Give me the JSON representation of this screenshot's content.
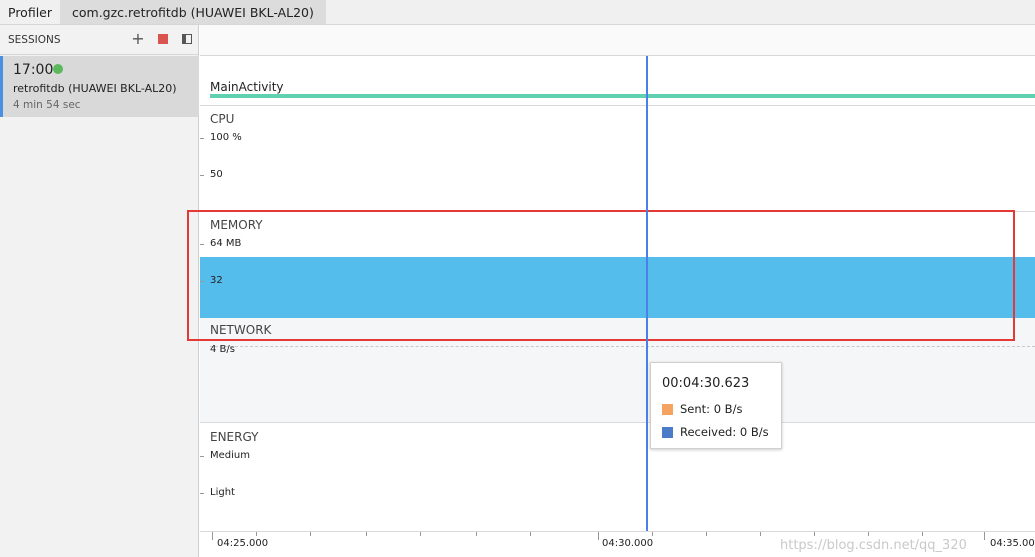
{
  "topbar": {
    "app_tab": "Profiler",
    "process_tab": "com.gzc.retrofitdb (HUAWEI BKL-AL20)"
  },
  "sessions": {
    "header": "SESSIONS",
    "item": {
      "time": "17:00",
      "device": "retrofitdb (HUAWEI BKL-AL20)",
      "duration": "4 min 54 sec",
      "status_color": "#5cb85c"
    }
  },
  "lanes": {
    "activity": {
      "label": "MainActivity",
      "color": "#5fd0b0"
    },
    "cpu": {
      "title": "CPU",
      "max_label": "100 %",
      "mid_label": "50"
    },
    "memory": {
      "title": "MEMORY",
      "max_label": "64 MB",
      "mid_label": "32",
      "fill_color": "#55bdec"
    },
    "network": {
      "title": "NETWORK",
      "max_label": "4 B/s"
    },
    "energy": {
      "title": "ENERGY",
      "high_label": "Medium",
      "low_label": "Light"
    }
  },
  "tooltip": {
    "time": "00:04:30.623",
    "sent": "Sent: 0 B/s",
    "received": "Received: 0 B/s",
    "sent_color": "#f4a460",
    "received_color": "#4a7cc7"
  },
  "timeline": {
    "labels": [
      "04:25.000",
      "04:30.000",
      "04:35.000"
    ],
    "watermark": "https://blog.csdn.net/qq_320"
  },
  "highlight_color": "#e53935"
}
